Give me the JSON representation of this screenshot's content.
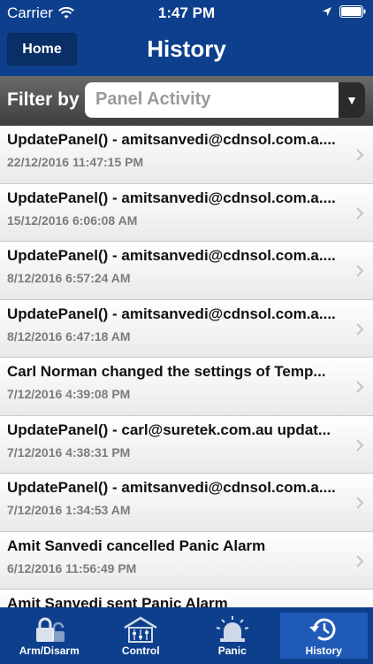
{
  "status_bar": {
    "carrier": "Carrier",
    "time": "1:47 PM"
  },
  "nav": {
    "home_label": "Home",
    "title": "History"
  },
  "filter": {
    "label": "Filter by",
    "value": "Panel Activity"
  },
  "history": [
    {
      "title": "UpdatePanel() - amitsanvedi@cdnsol.com.a....",
      "date": "22/12/2016 11:47:15 PM"
    },
    {
      "title": "UpdatePanel() - amitsanvedi@cdnsol.com.a....",
      "date": "15/12/2016 6:06:08 AM"
    },
    {
      "title": "UpdatePanel() - amitsanvedi@cdnsol.com.a....",
      "date": "8/12/2016 6:57:24 AM"
    },
    {
      "title": "UpdatePanel() - amitsanvedi@cdnsol.com.a....",
      "date": "8/12/2016 6:47:18 AM"
    },
    {
      "title": "Carl Norman changed the settings of Temp...",
      "date": "7/12/2016 4:39:08 PM"
    },
    {
      "title": "UpdatePanel() - carl@suretek.com.au updat...",
      "date": "7/12/2016 4:38:31 PM"
    },
    {
      "title": "UpdatePanel() - amitsanvedi@cdnsol.com.a....",
      "date": "7/12/2016 1:34:53 AM"
    },
    {
      "title": "Amit Sanvedi cancelled Panic Alarm",
      "date": "6/12/2016 11:56:49 PM"
    },
    {
      "title": "Amit Sanvedi sent Panic Alarm",
      "date": ""
    }
  ],
  "tabs": [
    {
      "label": "Arm/Disarm",
      "icon": "padlock-icon"
    },
    {
      "label": "Control",
      "icon": "control-panel-icon"
    },
    {
      "label": "Panic",
      "icon": "siren-icon"
    },
    {
      "label": "History",
      "icon": "history-icon"
    }
  ],
  "colors": {
    "brand_blue": "#0d3f8c",
    "active_tab": "#1f5ab7",
    "filter_bar": "#4a4a4a",
    "date_gray": "#7c7c7c"
  }
}
